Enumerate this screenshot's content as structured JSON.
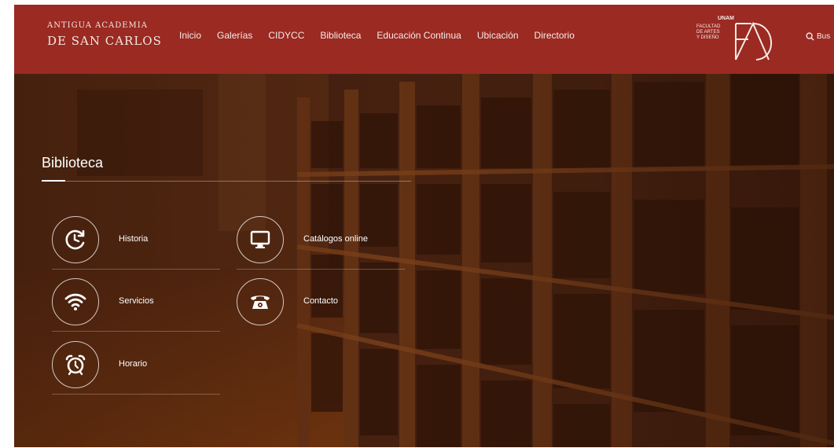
{
  "header": {
    "brand_line1": "ANTIGUA ACADEMIA",
    "brand_line2": "DE SAN CARLOS",
    "nav": [
      "Inicio",
      "Galerías",
      "CIDYCC",
      "Biblioteca",
      "Educación Continua",
      "Ubicación",
      "Directorio"
    ],
    "unam_title": "UNAM",
    "unam_sub": [
      "FACULTAD",
      "DE ARTES",
      "Y DISEÑO"
    ],
    "search_label": "Bus",
    "search_icon": "search-icon"
  },
  "hero": {
    "title": "Biblioteca",
    "items": [
      {
        "label": "Historia",
        "icon": "history-clock-icon"
      },
      {
        "label": "Catálogos online",
        "icon": "monitor-icon"
      },
      {
        "label": "Servicios",
        "icon": "wifi-icon"
      },
      {
        "label": "Contacto",
        "icon": "telephone-icon"
      },
      {
        "label": "Horario",
        "icon": "alarm-clock-icon"
      }
    ]
  },
  "colors": {
    "header_bg": "#9a2a22",
    "text_light": "#ffffff"
  }
}
